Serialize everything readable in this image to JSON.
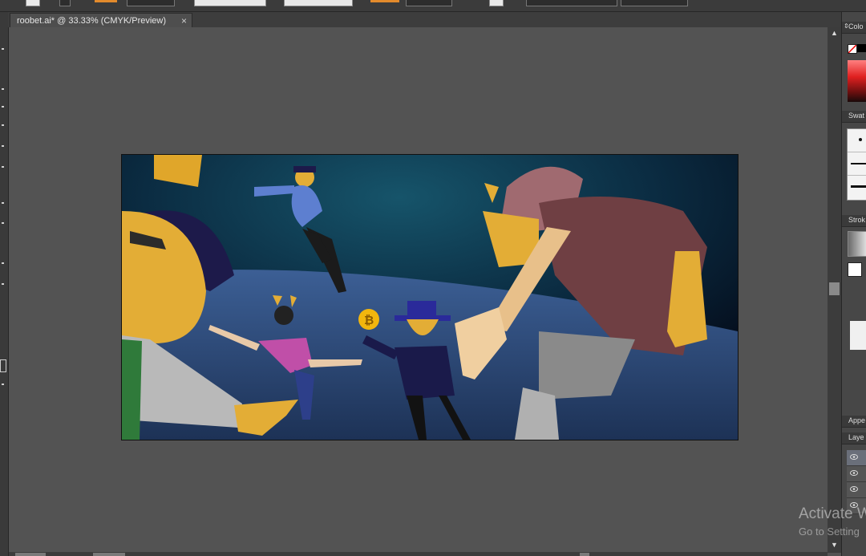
{
  "document": {
    "tab_title": "roobet.ai* @ 33.33% (CMYK/Preview)",
    "close_glyph": "×"
  },
  "right_panel": {
    "color_label": "Colo",
    "swatches_label": "Swat",
    "stroke_label": "Strok",
    "appearance_label": "Appe",
    "layers_label": "Laye"
  },
  "watermark": {
    "line1": "Activate W",
    "line2": "Go to Setting"
  },
  "colors": {
    "ui_dark": "#3b3b3b",
    "canvas_bg": "#535353",
    "accent_orange": "#e28a2c",
    "artwork_sky": "#0b2a3d",
    "artwork_ground": "#2f4a7a",
    "bitcoin_gold": "#f2b60e"
  },
  "icons": [
    "close-icon",
    "eye-icon",
    "scroll-up-icon",
    "scroll-down-icon",
    "collapse-arrow-icon"
  ]
}
